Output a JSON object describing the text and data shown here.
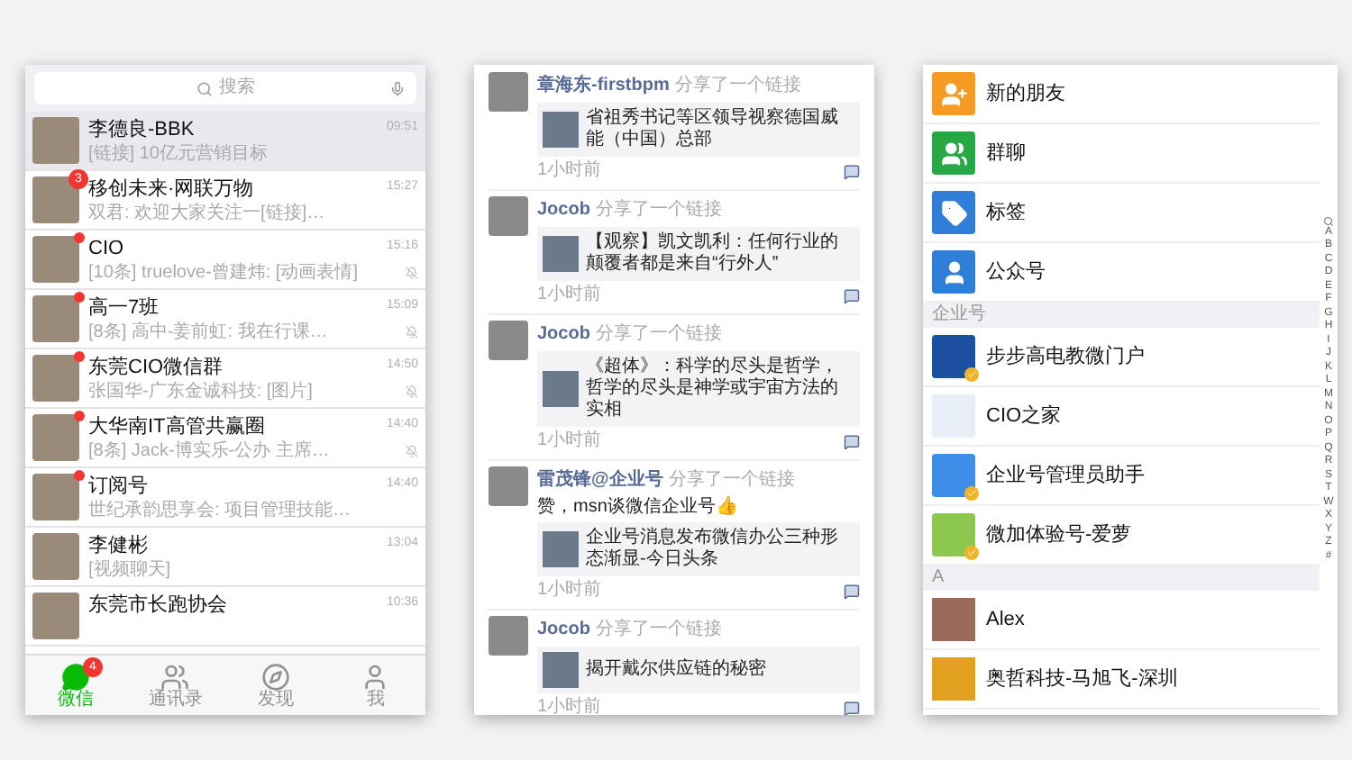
{
  "chats": {
    "search": {
      "placeholder": "搜索"
    },
    "items": [
      {
        "name": "李德良-BBK",
        "preview": "[链接] 10亿元营销目标",
        "time": "09:51",
        "dot": false,
        "muted": false,
        "selected": true
      },
      {
        "name": "移创未来·网联万物",
        "preview": "双君: 欢迎大家关注一[链接]…",
        "time": "15:27",
        "badge": "3",
        "dot": false,
        "muted": false,
        "selected": false
      },
      {
        "name": "CIO",
        "preview": "[10条] truelove-曾建炜: [动画表情]",
        "time": "15:16",
        "dot": true,
        "muted": true,
        "selected": false
      },
      {
        "name": "高一7班",
        "preview": "[8条] 高中-姜前虹: 我在行课…",
        "time": "15:09",
        "dot": true,
        "muted": true,
        "selected": false
      },
      {
        "name": "东莞CIO微信群",
        "preview": "张国华-广东金诚科技: [图片]",
        "time": "14:50",
        "dot": true,
        "muted": true,
        "selected": false
      },
      {
        "name": "大华南IT高管共赢圈",
        "preview": "[8条] Jack-博实乐-公办 主席…",
        "time": "14:40",
        "dot": true,
        "muted": true,
        "selected": false
      },
      {
        "name": "订阅号",
        "preview": "世纪承韵思享会: 项目管理技能…",
        "time": "14:40",
        "dot": true,
        "muted": false,
        "selected": false
      },
      {
        "name": "李健彬",
        "preview": "[视频聊天]",
        "time": "13:04",
        "dot": false,
        "muted": false,
        "selected": false
      },
      {
        "name": "东莞市长跑协会",
        "time": "10:36",
        "dot": false,
        "muted": false,
        "selected": false
      }
    ],
    "tabs": [
      {
        "kind": "chat",
        "label": "微信",
        "badge": "4",
        "selected": true
      },
      {
        "kind": "contacts",
        "label": "通讯录",
        "selected": false
      },
      {
        "kind": "discover",
        "label": "发现",
        "selected": false
      },
      {
        "kind": "me",
        "label": "我",
        "selected": false
      }
    ]
  },
  "feed": [
    {
      "author": "章海东-firstbpm",
      "action": "分享了一个链接",
      "link": "省祖秀书记等区领导视察德国威能（中国）总部",
      "time": "1小时前"
    },
    {
      "author": "Jocob",
      "action": "分享了一个链接",
      "link": "【观察】凯文凯利：任何行业的颠覆者都是来自“行外人”",
      "time": "1小时前"
    },
    {
      "author": "Jocob",
      "action": "分享了一个链接",
      "link": "《超体》：科学的尽头是哲学，哲学的尽头是神学或宇宙方法的实相",
      "time": "1小时前"
    },
    {
      "author": "雷茂锋@企业号",
      "action": "分享了一个链接",
      "comment": "赞，msn谈微信企业号👍",
      "link": "企业号消息发布微信办公三种形态渐显-今日头条",
      "time": "1小时前"
    },
    {
      "author": "Jocob",
      "action": "分享了一个链接",
      "link": "揭开戴尔供应链的秘密",
      "time": "1小时前"
    }
  ],
  "contacts": {
    "rows": [
      {
        "kind": "fixed",
        "label": "新的朋友",
        "color": "#f59a23"
      },
      {
        "kind": "fixed",
        "label": "群聊",
        "color": "#27a844"
      },
      {
        "kind": "fixed",
        "label": "标签",
        "color": "#2f7fd8"
      },
      {
        "kind": "fixed",
        "label": "公众号",
        "color": "#2f7fd8"
      },
      {
        "kind": "header",
        "label": "企业号"
      },
      {
        "kind": "account",
        "label": "步步高电教微门户",
        "color": "#1b4fa0",
        "verified": true
      },
      {
        "kind": "account",
        "label": "CIO之家",
        "color": "#e8eef6",
        "verified": false
      },
      {
        "kind": "account",
        "label": "企业号管理员助手",
        "color": "#3d8ee8",
        "verified": true
      },
      {
        "kind": "account",
        "label": "微加体验号-爱萝",
        "color": "#8cc850",
        "verified": true
      },
      {
        "kind": "header",
        "label": "A"
      },
      {
        "kind": "person",
        "label": "Alex",
        "color": "#9a6a5a"
      },
      {
        "kind": "person",
        "label": "奥哲科技-马旭飞-深圳",
        "color": "#e0a020"
      }
    ],
    "index": [
      "A",
      "B",
      "C",
      "D",
      "E",
      "F",
      "G",
      "H",
      "I",
      "J",
      "K",
      "L",
      "M",
      "N",
      "O",
      "P",
      "Q",
      "R",
      "S",
      "T",
      "W",
      "X",
      "Y",
      "Z",
      "#"
    ]
  }
}
